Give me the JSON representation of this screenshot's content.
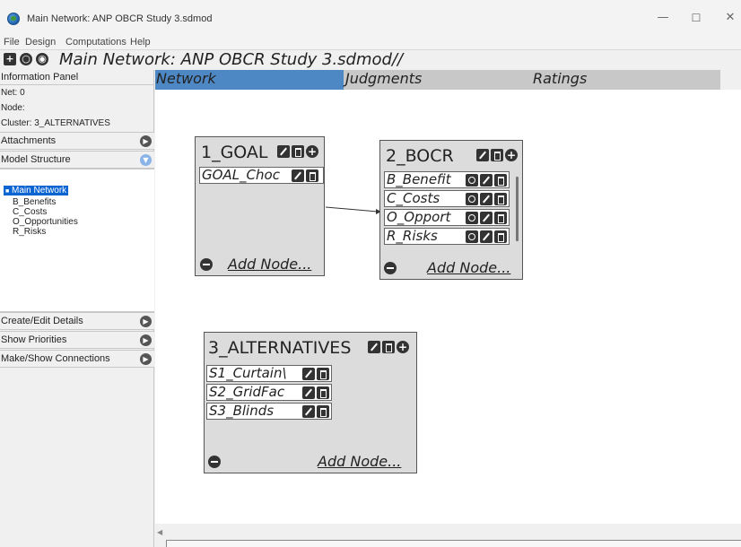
{
  "window": {
    "title": "Main Network: ANP OBCR Study 3.sdmod",
    "minimize_label": "—",
    "maximize_label": "☐",
    "close_label": "✕"
  },
  "menu": {
    "items": [
      "File",
      "Design",
      "Computations",
      "Help"
    ]
  },
  "network": {
    "title": "Main Network: ANP OBCR Study 3.sdmod//"
  },
  "info_panel": {
    "header": "Information Panel",
    "net": "Net: 0",
    "node": "Node:",
    "cluster": "Cluster: 3_ALTERNATIVES"
  },
  "sections": {
    "attachments": "Attachments",
    "model_structure": "Model Structure",
    "create_edit": "Create/Edit Details",
    "show_priorities": "Show Priorities",
    "make_show_connections": "Make/Show Connections"
  },
  "tree": {
    "root": "Main Network",
    "children": [
      "B_Benefits",
      "C_Costs",
      "O_Opportunities",
      "R_Risks"
    ]
  },
  "tabs": [
    "Network",
    "Judgments",
    "Ratings"
  ],
  "clusters": {
    "goal": {
      "title": "1_GOAL",
      "nodes": [
        "GOAL_Choc"
      ],
      "add_node": "Add Node..."
    },
    "bocr": {
      "title": "2_BOCR",
      "nodes": [
        "B_Benefit",
        "C_Costs",
        "O_Opport",
        "R_Risks"
      ],
      "add_node": "Add Node..."
    },
    "alternatives": {
      "title": "3_ALTERNATIVES",
      "nodes": [
        "S1_Curtain\\",
        "S2_GridFac",
        "S3_Blinds"
      ],
      "add_node": "Add Node..."
    }
  },
  "colors": {
    "active_tab": "#4e88c4",
    "tree_selection": "#0a64d2",
    "cluster_bg": "#dcdcdc"
  }
}
